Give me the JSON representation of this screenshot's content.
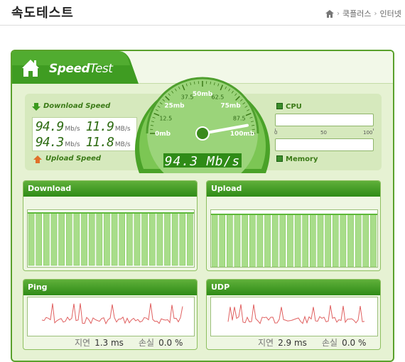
{
  "page": {
    "title": "속도테스트",
    "breadcrumb": [
      "쿡플러스",
      "인터넷"
    ]
  },
  "widget": {
    "logo_bold": "Speed",
    "logo_thin": "Test",
    "download_label": "Download Speed",
    "upload_label": "Upload Speed",
    "download_mbps": "94.9",
    "download_unit": "Mb/s",
    "download_mbytes": "11.9",
    "download_mbytes_unit": "MB/s",
    "upload_mbps": "94.3",
    "upload_unit": "Mb/s",
    "upload_mbytes": "11.8",
    "upload_mbytes_unit": "MB/s",
    "cpu_label": "CPU",
    "memory_label": "Memory",
    "scale_labels": [
      "0",
      "50",
      "100"
    ],
    "gauge_current": "94.3",
    "gauge_unit": "Mb/s",
    "gauge_labels": [
      {
        "text": "0mb"
      },
      {
        "text": "12.5"
      },
      {
        "text": "25mb"
      },
      {
        "text": "37.5"
      },
      {
        "text": "50mb"
      },
      {
        "text": "62.5"
      },
      {
        "text": "75mb"
      },
      {
        "text": "87.5"
      },
      {
        "text": "100mb"
      }
    ],
    "gauge_value": 94.3,
    "gauge_max": 100
  },
  "panels": {
    "download": {
      "title": "Download"
    },
    "upload": {
      "title": "Upload"
    },
    "ping": {
      "title": "Ping",
      "stat1_key": "지연",
      "stat1_value": "1.3 ms",
      "stat2_key": "손실",
      "stat2_value": "0.0 %"
    },
    "udp": {
      "title": "UDP",
      "stat1_key": "지연",
      "stat1_value": "2.9 ms",
      "stat2_key": "손실",
      "stat2_value": "0.0 %"
    }
  },
  "colors": {
    "accent": "#3b9a1e",
    "panel_bg": "#e6f2d3",
    "line": "#e06060"
  }
}
